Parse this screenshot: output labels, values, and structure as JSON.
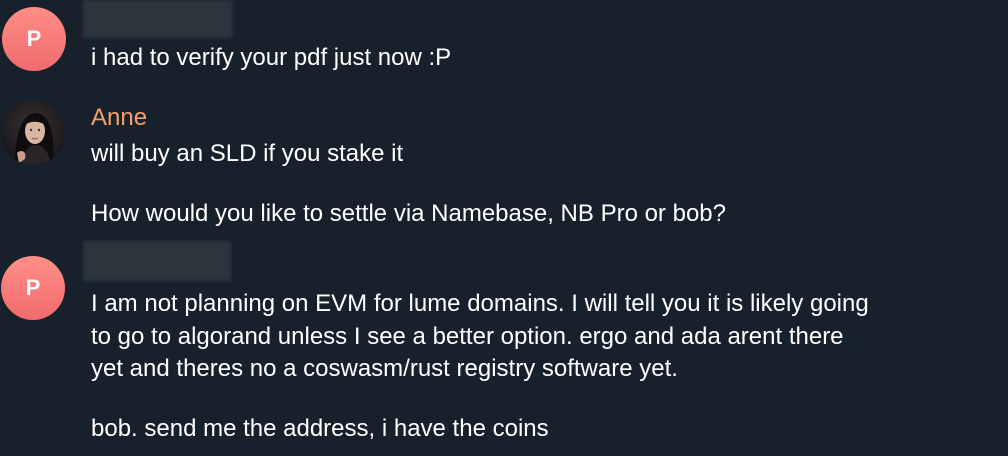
{
  "messages": [
    {
      "sender_initial": "P",
      "lines": [
        "i had to verify your pdf just now :P"
      ]
    },
    {
      "sender_name": "Anne",
      "lines": [
        "will buy an SLD if you stake it",
        "How would you like to settle via Namebase, NB Pro or bob?"
      ]
    },
    {
      "sender_initial": "P",
      "lines": [
        "I am not planning on EVM for lume domains. I will tell you it is likely going",
        "to go to algorand unless I see a better option. ergo and ada arent there",
        "yet and theres no a coswasm/rust registry software yet.",
        "bob. send me the address, i have the coins"
      ]
    }
  ],
  "colors": {
    "background": "#17212b",
    "avatar_gradient_top": "#ff8e86",
    "avatar_gradient_bottom": "#f06b6d",
    "sender_name": "#f5a06a",
    "text": "#ffffff"
  }
}
